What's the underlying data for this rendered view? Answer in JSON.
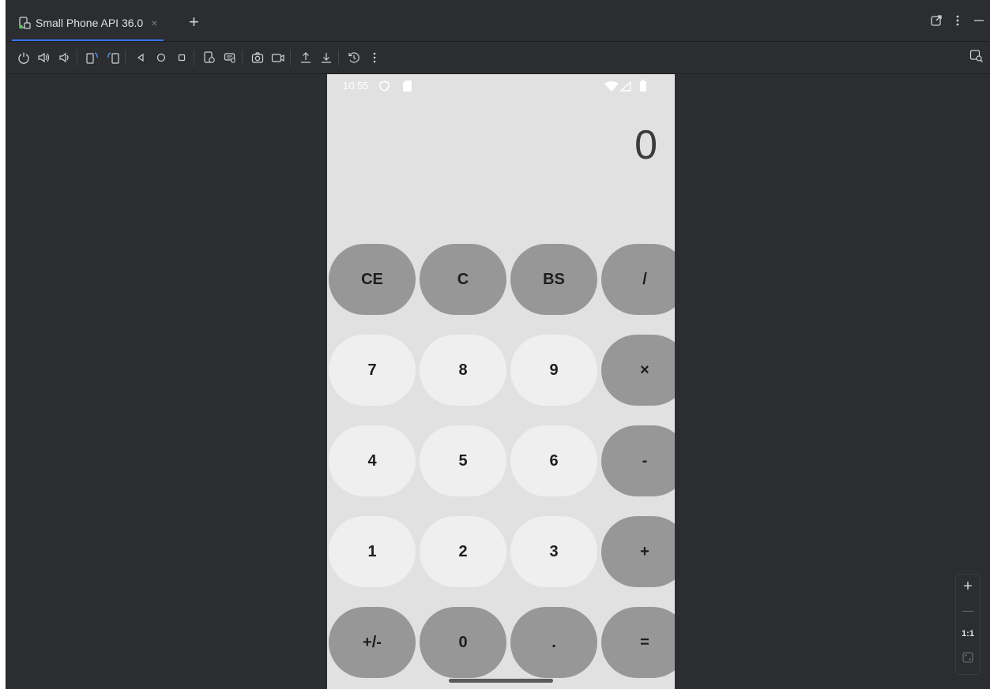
{
  "tab": {
    "label": "Small Phone API 36.0",
    "close": "×",
    "add": "+"
  },
  "toolbar": {
    "icons": [
      "power-icon",
      "volume-up-icon",
      "volume-down-icon",
      "rotate-left-icon",
      "rotate-right-icon",
      "back-icon",
      "home-icon",
      "overview-icon",
      "device-settings-icon",
      "keyboard-icon",
      "screenshot-icon",
      "screen-record-icon",
      "upload-icon",
      "download-icon",
      "snapshot-icon",
      "more-icon"
    ]
  },
  "phone": {
    "status": {
      "time": "10:55"
    },
    "display": "0",
    "keys": [
      [
        "CE",
        "C",
        "BS",
        "/"
      ],
      [
        "7",
        "8",
        "9",
        "×"
      ],
      [
        "4",
        "5",
        "6",
        "-"
      ],
      [
        "1",
        "2",
        "3",
        "+"
      ],
      [
        "+/-",
        "0",
        ".",
        "="
      ]
    ]
  },
  "zoom": {
    "in": "+",
    "out": "—",
    "actual": "1:1"
  },
  "colors": {
    "ide_bg": "#2b2d30",
    "accent": "#3574f0",
    "phone_bg": "#e1e1e1",
    "key_dark": "#979797",
    "key_light": "#efefef"
  }
}
